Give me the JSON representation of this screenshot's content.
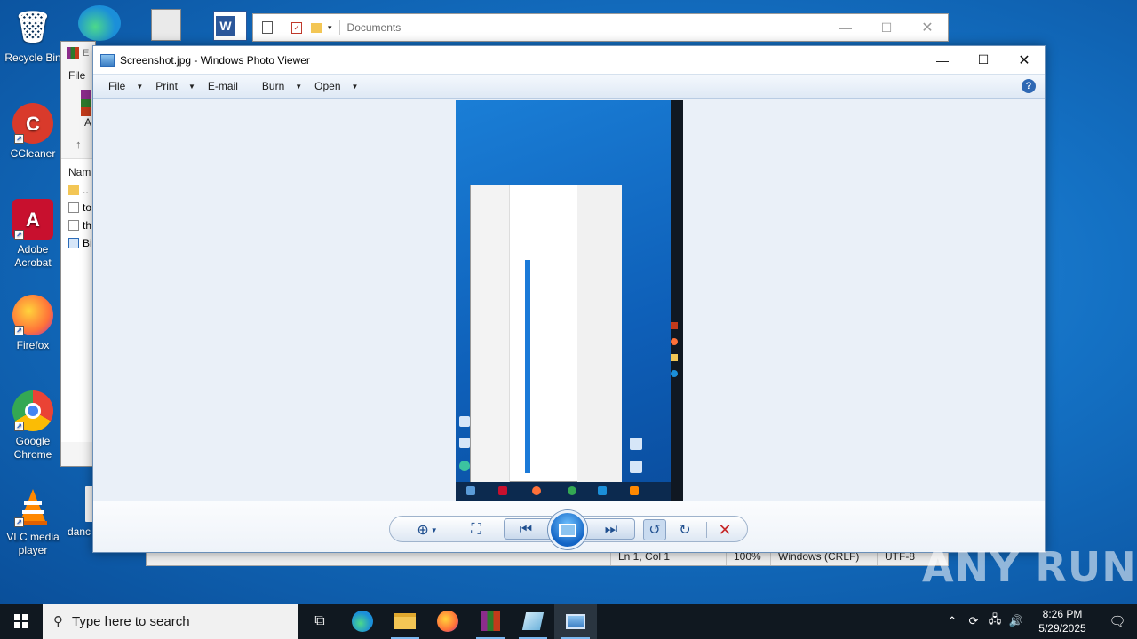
{
  "desktop": {
    "icons": [
      {
        "label": "Recycle Bin",
        "glyph": "🗑",
        "color": "#4d86c9"
      },
      {
        "label": "CCleaner",
        "glyph": "C",
        "color": "#d93a2b"
      },
      {
        "label": "Adobe Acrobat",
        "glyph": "A",
        "color": "#c8102e"
      },
      {
        "label": "Firefox",
        "glyph": "ff",
        "color": "#ff7139"
      },
      {
        "label": "Google Chrome",
        "glyph": "●",
        "color": "#2f9e44"
      },
      {
        "label": "VLC media player",
        "glyph": "▲",
        "color": "#ff8800"
      }
    ],
    "partial_icon_label": "danc"
  },
  "notepad": {
    "title": "Documents",
    "status": {
      "position": "Ln 1, Col 1",
      "zoom": "100%",
      "line_ending": "Windows (CRLF)",
      "encoding": "UTF-8"
    }
  },
  "explorer": {
    "menu_file": "File",
    "col_name": "Nam",
    "row_letter": "A",
    "rows": [
      "..",
      "to",
      "th",
      "Bi"
    ]
  },
  "photo_viewer": {
    "title": "Screenshot.jpg - Windows Photo Viewer",
    "menu": [
      {
        "label": "File",
        "has_arrow": true
      },
      {
        "label": "Print",
        "has_arrow": true
      },
      {
        "label": "E-mail",
        "has_arrow": false
      },
      {
        "label": "Burn",
        "has_arrow": true
      },
      {
        "label": "Open",
        "has_arrow": true
      }
    ],
    "help": "?"
  },
  "taskbar": {
    "search_placeholder": "Type here to search",
    "time": "8:26 PM",
    "date": "5/29/2025"
  },
  "watermark": "ANY RUN",
  "colors": {
    "desktop_bg": "#1479c9",
    "taskbar_bg": "#101820",
    "viewer_canvas": "#eaf0f8",
    "accent": "#1263c4"
  }
}
